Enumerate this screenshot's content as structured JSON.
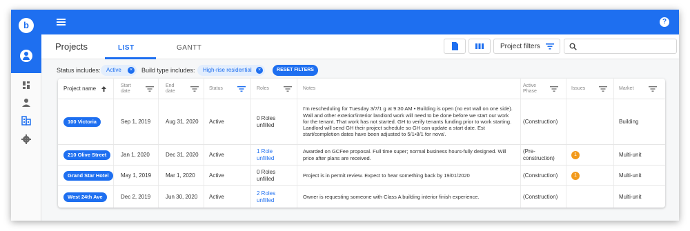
{
  "logo": "b",
  "help_icon": "?",
  "page_title": "Projects",
  "tabs": [
    {
      "label": "LIST",
      "active": true
    },
    {
      "label": "GANTT",
      "active": false
    }
  ],
  "toolbar": {
    "filters_label": "Project filters",
    "search_placeholder": ""
  },
  "filters": {
    "status_label": "Status includes:",
    "status_value": "Active",
    "build_label": "Build type includes:",
    "build_value": "High-rise residential",
    "reset_label": "RESET FILTERS",
    "clear_icon": "×"
  },
  "columns": [
    {
      "label": "Project name"
    },
    {
      "label": "Start date"
    },
    {
      "label": "End date"
    },
    {
      "label": "Status"
    },
    {
      "label": "Roles"
    },
    {
      "label": "Notes"
    },
    {
      "label": "Active Phase"
    },
    {
      "label": "Issues"
    },
    {
      "label": "Market"
    }
  ],
  "rows": [
    {
      "name": "100 Victoria",
      "start": "Sep 1, 2019",
      "end": "Aug 31, 2020",
      "status": "Active",
      "roles": "0 Roles unfilled",
      "roles_link": false,
      "notes": "I'm rescheduling for Tuesday 3/7/1 g at 9:30 AM • Building is open (no ext wall on one side). Wall and other exterior/interior landlord work will need to be done before we start our work for the tenant. That work has not started. GH to verify tenants funding prior to work starting. Landlord will send GH their project schedule so GH can update a start date. Est start/completion dates have been adjusted to 5/1•8/1 for nova'.",
      "phase": "(Construction)",
      "issues": "",
      "market": "Building"
    },
    {
      "name": "210 Olive Street",
      "start": "Jan 1, 2020",
      "end": "Dec 31, 2020",
      "status": "Active",
      "roles": "1 Role unfilled",
      "roles_link": true,
      "notes": "Awarded on GCFee proposal. Full time super; normal business hours-fully designed. Will price after plans are received.",
      "phase": "(Pre-construction)",
      "issues": "1",
      "market": "Multi-unit"
    },
    {
      "name": "Grand Star Hotel",
      "start": "May 1, 2019",
      "end": "Mar 1, 2020",
      "status": "Active",
      "roles": "0 Roles unfilled",
      "roles_link": false,
      "notes": "Project is in permit review. Expect to hear something back by 19/01/2020",
      "phase": "(Construction)",
      "issues": "1",
      "market": "Multi-unit"
    },
    {
      "name": "West 24th Ave",
      "start": "Dec 2, 2019",
      "end": "Jun 30, 2020",
      "status": "Active",
      "roles": "2 Roles unfilled",
      "roles_link": true,
      "notes": "Owner is requesting someone with Class A building interior finish experience.",
      "phase": "(Construction)",
      "issues": "",
      "market": "Multi-unit"
    }
  ],
  "colors": {
    "brand": "#1e6ff0",
    "issue": "#f29a1c"
  }
}
